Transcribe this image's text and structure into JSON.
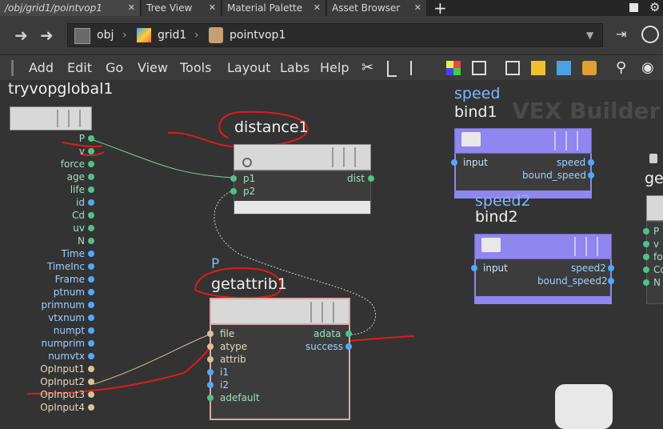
{
  "tabs": [
    {
      "label": "/obj/grid1/pointvop1",
      "active": true
    },
    {
      "label": "Tree View"
    },
    {
      "label": "Material Palette"
    },
    {
      "label": "Asset Browser"
    }
  ],
  "tab_add": "+",
  "path": {
    "crumbs": [
      "obj",
      "grid1",
      "pointvop1"
    ]
  },
  "menu": [
    "Add",
    "Edit",
    "Go",
    "View",
    "Tools",
    "Layout",
    "Labs",
    "Help"
  ],
  "network": {
    "watermark": "VEX Builder",
    "global_node": {
      "title": "tryvopglobal1",
      "outputs": [
        "P",
        "v",
        "force",
        "age",
        "life",
        "id",
        "Cd",
        "uv",
        "N",
        "Time",
        "TimeInc",
        "Frame",
        "ptnum",
        "primnum",
        "vtxnum",
        "numpt",
        "numprim",
        "numvtx",
        "OpInput1",
        "OpInput2",
        "OpInput3",
        "OpInput4"
      ]
    },
    "distance_node": {
      "title": "distance1",
      "inputs": [
        "p1",
        "p2"
      ],
      "outputs": [
        "dist"
      ]
    },
    "getattrib_node": {
      "label": "P",
      "title": "getattrib1",
      "inputs": [
        "file",
        "atype",
        "attrib",
        "i1",
        "i2",
        "adefault"
      ],
      "outputs": [
        "adata",
        "success"
      ]
    },
    "bind1_node": {
      "label": "speed",
      "title": "bind1",
      "inputs": [
        "input"
      ],
      "outputs": [
        "speed",
        "bound_speed"
      ]
    },
    "bind2_node": {
      "label": "speed2",
      "title": "bind2",
      "inputs": [
        "input"
      ],
      "outputs": [
        "speed2",
        "bound_speed2"
      ]
    },
    "partial_node": {
      "title": "ge",
      "outputs": [
        "P",
        "v",
        "fo",
        "Co",
        "N"
      ]
    }
  },
  "colors": {
    "port_green": "#4fc28a",
    "port_blue": "#4fa9ff",
    "port_tan": "#d9c29a",
    "bind_purple": "#8f86f0",
    "annotation_red": "#e11a1a"
  }
}
